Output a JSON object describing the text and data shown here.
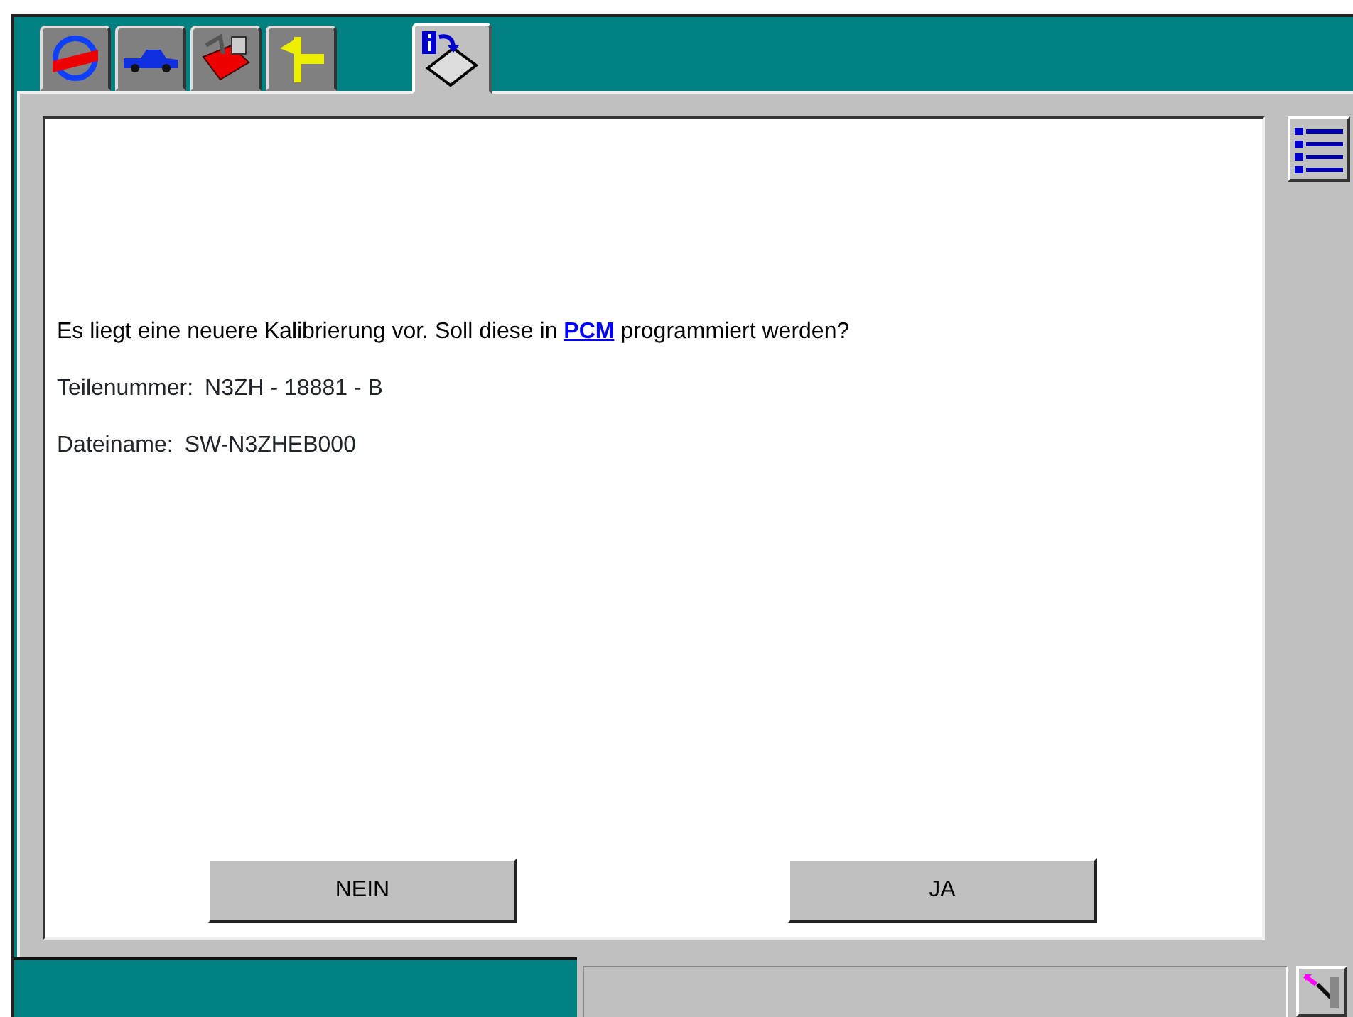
{
  "tabs": [
    {
      "kind": "logo",
      "selected": false
    },
    {
      "kind": "vehicle",
      "selected": false
    },
    {
      "kind": "toolbox",
      "selected": false
    },
    {
      "kind": "signpost",
      "selected": false
    },
    {
      "kind": "info-disk",
      "selected": true
    }
  ],
  "dialog": {
    "message": {
      "before": "Es liegt eine neuere Kalibrierung vor. Soll diese in ",
      "link": "PCM",
      "after": " programmiert werden?"
    },
    "fields": [
      {
        "label": "Teilenummer:",
        "value": "N3ZH - 18881 - B"
      },
      {
        "label": "Dateiname:",
        "value": "SW-N3ZHEB000"
      }
    ],
    "buttons": [
      "NEIN",
      "JA"
    ]
  }
}
